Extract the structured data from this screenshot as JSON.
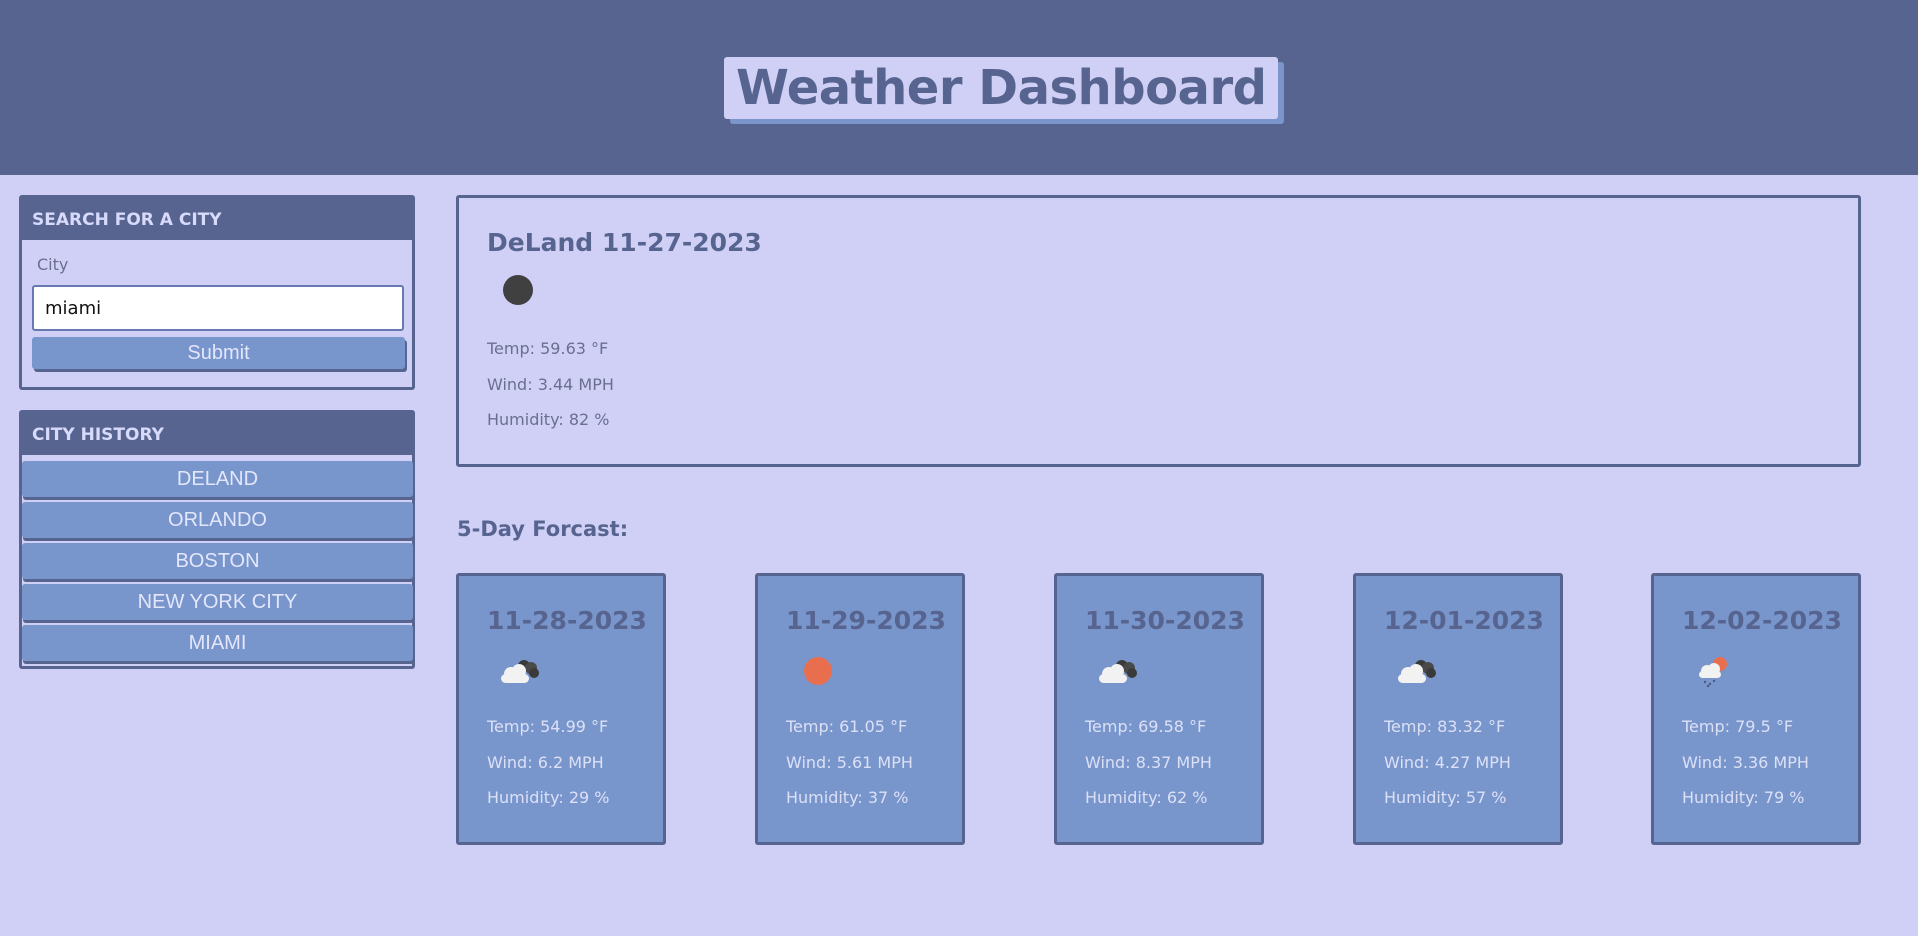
{
  "header": {
    "title": "Weather Dashboard"
  },
  "search": {
    "heading": "SEARCH FOR A CITY",
    "label": "City",
    "value": "miami",
    "submit_label": "Submit"
  },
  "history": {
    "heading": "CITY HISTORY",
    "cities": [
      "DELAND",
      "ORLANDO",
      "BOSTON",
      "NEW YORK CITY",
      "MIAMI"
    ]
  },
  "current": {
    "title": "DeLand 11-27-2023",
    "icon": "moon-clear-icon",
    "temp": "Temp: 59.63 °F",
    "wind": "Wind: 3.44 MPH",
    "humidity": "Humidity: 82 %"
  },
  "forecast": {
    "heading": "5-Day Forcast:",
    "days": [
      {
        "date": "11-28-2023",
        "icon": "broken-clouds-icon",
        "temp": "Temp: 54.99 °F",
        "wind": "Wind: 6.2 MPH",
        "humidity": "Humidity: 29 %"
      },
      {
        "date": "11-29-2023",
        "icon": "clear-sun-icon",
        "temp": "Temp: 61.05 °F",
        "wind": "Wind: 5.61 MPH",
        "humidity": "Humidity: 37 %"
      },
      {
        "date": "11-30-2023",
        "icon": "broken-clouds-icon",
        "temp": "Temp: 69.58 °F",
        "wind": "Wind: 8.37 MPH",
        "humidity": "Humidity: 62 %"
      },
      {
        "date": "12-01-2023",
        "icon": "broken-clouds-icon",
        "temp": "Temp: 83.32 °F",
        "wind": "Wind: 4.27 MPH",
        "humidity": "Humidity: 57 %"
      },
      {
        "date": "12-02-2023",
        "icon": "sun-rain-icon",
        "temp": "Temp: 79.5 °F",
        "wind": "Wind: 3.36 MPH",
        "humidity": "Humidity: 79 %"
      }
    ]
  },
  "colors": {
    "background": "#d0d0f7",
    "header": "#56648f",
    "accent": "#7896cb",
    "shadow": "#7a96cb",
    "sun": "#e86e4d",
    "moon": "#404040"
  }
}
